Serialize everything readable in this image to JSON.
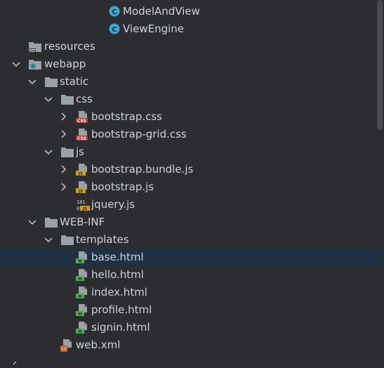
{
  "tree": {
    "items": [
      {
        "label": "ModelAndView",
        "icon": "class-icon"
      },
      {
        "label": "ViewEngine",
        "icon": "class-icon"
      },
      {
        "label": "resources",
        "icon": "resources-folder-icon"
      },
      {
        "label": "webapp",
        "icon": "web-folder-icon"
      },
      {
        "label": "static",
        "icon": "folder-icon"
      },
      {
        "label": "css",
        "icon": "folder-icon"
      },
      {
        "label": "bootstrap.css",
        "icon": "css-file-icon"
      },
      {
        "label": "bootstrap-grid.css",
        "icon": "css-file-icon"
      },
      {
        "label": "js",
        "icon": "folder-icon"
      },
      {
        "label": "bootstrap.bundle.js",
        "icon": "js-file-icon"
      },
      {
        "label": "bootstrap.js",
        "icon": "js-file-icon"
      },
      {
        "label": "jquery.js",
        "icon": "minified-js-file-icon"
      },
      {
        "label": "WEB-INF",
        "icon": "folder-icon"
      },
      {
        "label": "templates",
        "icon": "folder-icon"
      },
      {
        "label": "base.html",
        "icon": "html-file-icon"
      },
      {
        "label": "hello.html",
        "icon": "html-file-icon"
      },
      {
        "label": "index.html",
        "icon": "html-file-icon"
      },
      {
        "label": "profile.html",
        "icon": "html-file-icon"
      },
      {
        "label": "signin.html",
        "icon": "html-file-icon"
      },
      {
        "label": "web.xml",
        "icon": "xml-file-icon"
      }
    ],
    "selected": "base.html"
  },
  "colors": {
    "background": "#2b2d30",
    "selection": "#1f3245",
    "text": "#cfd3d8",
    "class_icon": "#3fa6d1",
    "css_badge": "#c0392b",
    "js_badge": "#d4a017",
    "html_badge": "#4caf50",
    "folder": "#9aa1a8"
  }
}
